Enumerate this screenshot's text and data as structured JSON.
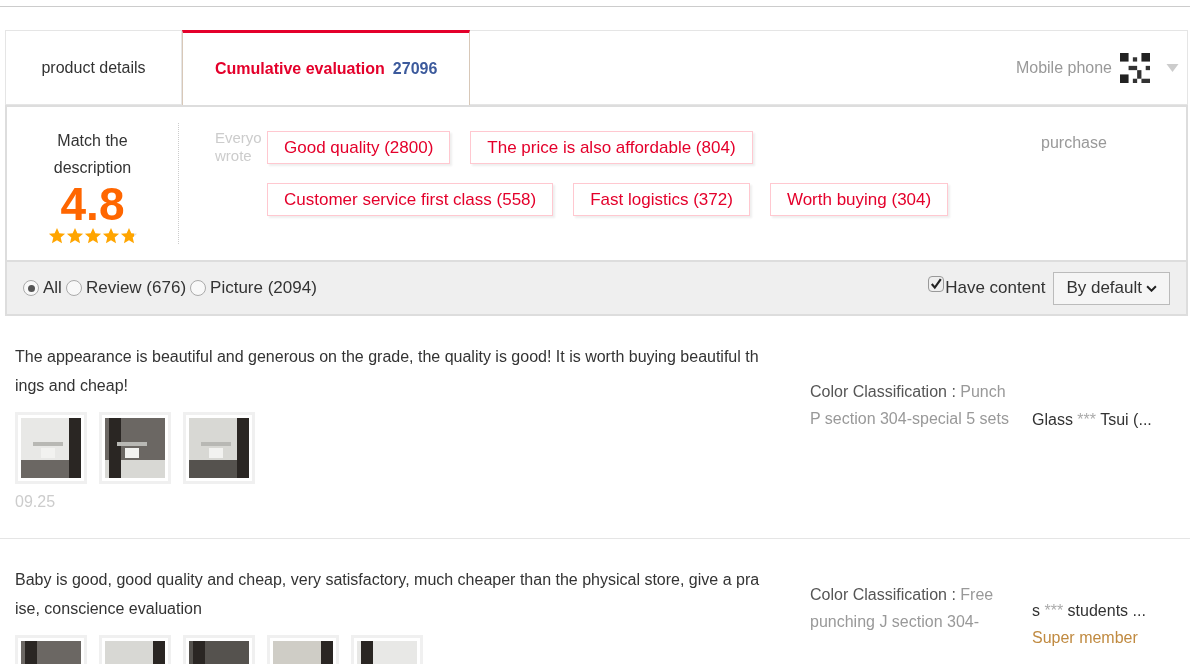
{
  "tabs": [
    {
      "label": "product details",
      "selected": false
    },
    {
      "label": "Cumulative evaluation",
      "count": "27096",
      "selected": true
    }
  ],
  "mobile": {
    "label": "Mobile phone"
  },
  "summary": {
    "title": "Match the description",
    "score": "4.8",
    "stars": 4.8,
    "hint": "Everyo",
    "hint2": "wrote",
    "purchase": "purchase",
    "tags": [
      [
        "Good quality (2800)",
        "The price is also affordable (804)"
      ],
      [
        "Customer service first class (558)",
        "Fast logistics (372)",
        "Worth buying (304)"
      ]
    ]
  },
  "filters": [
    {
      "label": "All",
      "selected": true
    },
    {
      "label": "Review (676)",
      "selected": false
    },
    {
      "label": "Picture (2094)",
      "selected": false
    }
  ],
  "have_content": {
    "label": "Have content",
    "checked": true
  },
  "sort": {
    "label": "By default"
  },
  "reviews": [
    {
      "text": "The appearance is beautiful and generous on the grade, the quality is good! It is worth buying beautiful things and cheap!",
      "date": "09.25",
      "color_label": "Color Classification :",
      "color_value": "Punch P section 304-special 5 sets",
      "user": "Glass",
      "mask": "***",
      "user_end": "Tsui (..."
    },
    {
      "text": "Baby is good, good quality and cheap, very satisfactory, much cheaper than the physical store, give a praise, conscience evaluation",
      "color_label": "Color Classification :",
      "color_value": "Free punching J section 304-",
      "user": "s",
      "mask": "***",
      "user_end": "students ...",
      "member": "Super member"
    }
  ]
}
